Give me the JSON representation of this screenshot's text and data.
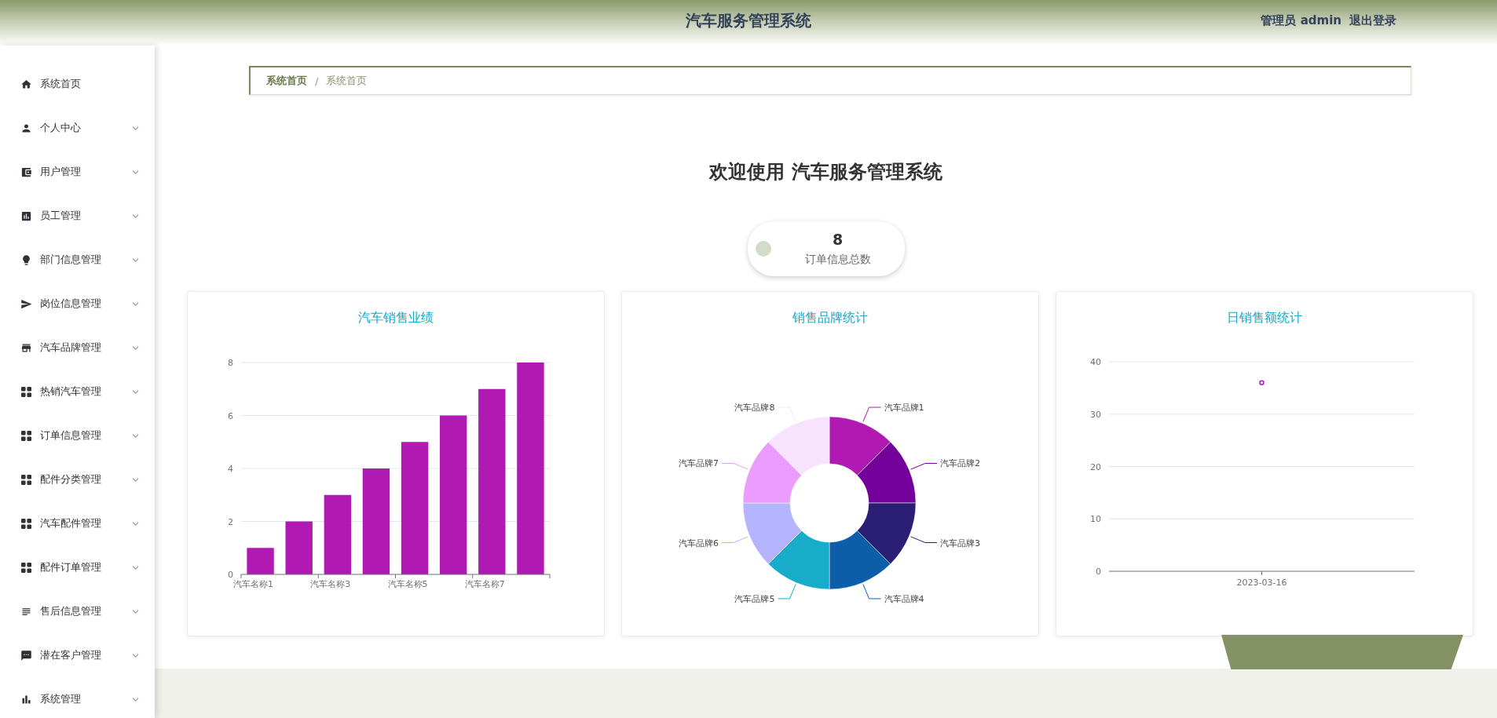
{
  "header": {
    "title": "汽车服务管理系统",
    "user": "管理员 admin",
    "logout": "退出登录"
  },
  "sidebar": {
    "items": [
      {
        "label": "系统首页",
        "kind": "link"
      },
      {
        "label": "个人中心",
        "kind": "menu",
        "expanded": false
      },
      {
        "label": "用户管理",
        "kind": "menu",
        "expanded": false
      },
      {
        "label": "员工管理",
        "kind": "menu",
        "expanded": false
      },
      {
        "label": "部门信息管理",
        "kind": "menu",
        "expanded": false
      },
      {
        "label": "岗位信息管理",
        "kind": "menu",
        "expanded": false
      },
      {
        "label": "汽车品牌管理",
        "kind": "menu",
        "expanded": false
      },
      {
        "label": "热销汽车管理",
        "kind": "menu",
        "expanded": false
      },
      {
        "label": "订单信息管理",
        "kind": "menu",
        "expanded": false
      },
      {
        "label": "配件分类管理",
        "kind": "menu",
        "expanded": false
      },
      {
        "label": "汽车配件管理",
        "kind": "menu",
        "expanded": false
      },
      {
        "label": "配件订单管理",
        "kind": "menu",
        "expanded": false
      },
      {
        "label": "售后信息管理",
        "kind": "menu",
        "expanded": false
      },
      {
        "label": "潜在客户管理",
        "kind": "menu",
        "expanded": false
      },
      {
        "label": "系统管理",
        "kind": "menu",
        "expanded": false
      }
    ]
  },
  "breadcrumb": {
    "items": [
      "系统首页",
      "系统首页"
    ],
    "separator": "/"
  },
  "welcome": "欢迎使用 汽车服务管理系统",
  "stat": {
    "value": "8",
    "label": "订单信息总数",
    "color": "#d3dbc9"
  },
  "charts": [
    {
      "title": "汽车销售业绩",
      "chart_data": {
        "type": "bar",
        "categories": [
          "汽车名称1",
          null,
          "汽车名称3",
          null,
          "汽车名称5",
          null,
          "汽车名称7",
          null
        ],
        "values": [
          1,
          2,
          3,
          4,
          5,
          6,
          7,
          8
        ],
        "color": "#b01ab3",
        "ylim": [
          0,
          8
        ],
        "yticks": [
          0,
          2,
          4,
          6,
          8
        ],
        "grid": true
      }
    },
    {
      "title": "销售品牌统计",
      "chart_data": {
        "type": "donut",
        "categories": [
          "汽车品牌1",
          "汽车品牌2",
          "汽车品牌3",
          "汽车品牌4",
          "汽车品牌5",
          "汽车品牌6",
          "汽车品牌7",
          "汽车品牌8"
        ],
        "values": [
          1,
          1,
          1,
          1,
          1,
          1,
          1,
          1
        ],
        "colors": [
          "#b01ab3",
          "#73009a",
          "#2a1f75",
          "#0c5ea8",
          "#17acca",
          "#b4b4ff",
          "#eb9cff",
          "#f8e3ff"
        ]
      }
    },
    {
      "title": "日销售额统计",
      "chart_data": {
        "type": "line",
        "x": [
          "2023-03-16"
        ],
        "ylim": [
          0,
          40
        ],
        "yticks": [
          0,
          10,
          20,
          30,
          40
        ],
        "grid": true,
        "series": [
          {
            "color": "#b01ab3",
            "marker": "circle",
            "values": [
              36
            ]
          }
        ]
      }
    }
  ]
}
